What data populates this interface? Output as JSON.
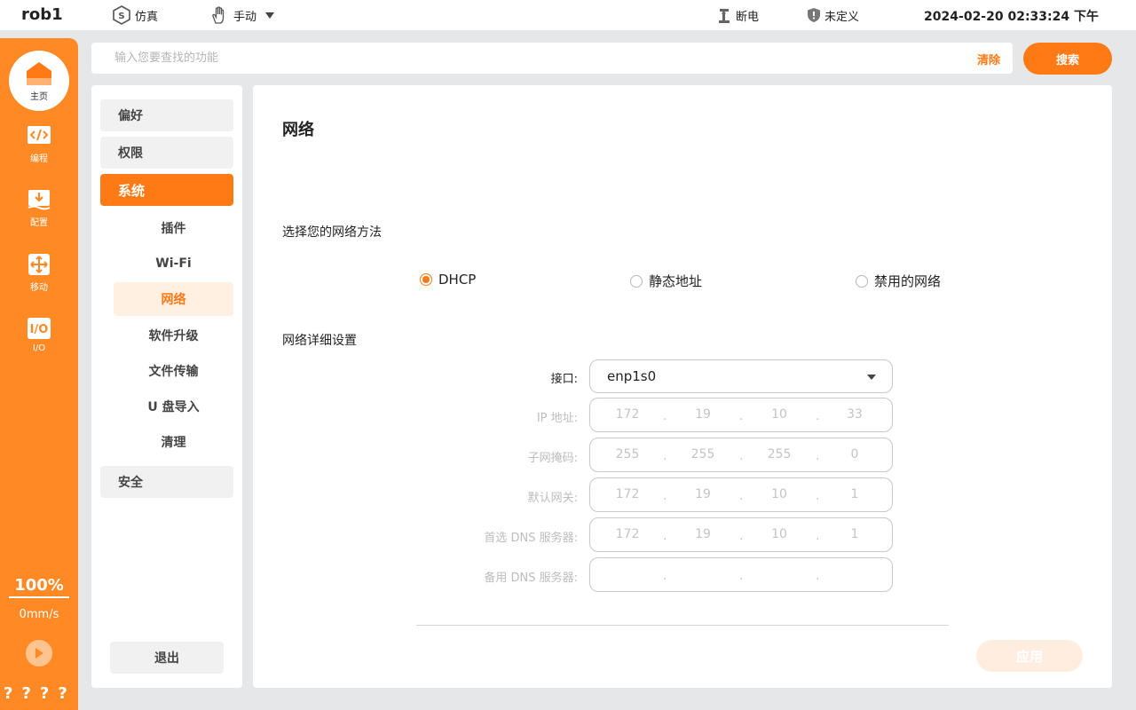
{
  "topbar": {
    "robot_name": "rob1",
    "sim_label": "仿真",
    "mode_label": "手动",
    "power_label": "断电",
    "safety_label": "未定义",
    "datetime": "2024-02-20 02:33:24 下午"
  },
  "rail": {
    "home_label": "主页",
    "items": [
      {
        "label": "编程",
        "icon": "code-icon"
      },
      {
        "label": "配置",
        "icon": "download-config-icon"
      },
      {
        "label": "移动",
        "icon": "move-arrows-icon"
      },
      {
        "label": "I/O",
        "icon": "io-icon"
      }
    ],
    "speed_percent": "100%",
    "speed_mm": "0mm/s",
    "question_marks": [
      "?",
      "?",
      "?",
      "?"
    ]
  },
  "search": {
    "placeholder": "输入您要查找的功能",
    "clear_label": "清除",
    "button_label": "搜索"
  },
  "nav": {
    "top_items": [
      "偏好",
      "权限",
      "系统",
      "安全"
    ],
    "sub_items": [
      "插件",
      "Wi-Fi",
      "网络",
      "软件升级",
      "文件传输",
      "U 盘导入",
      "清理"
    ],
    "logout_label": "退出"
  },
  "network": {
    "title": "网络",
    "method_label": "选择您的网络方法",
    "options": [
      "DHCP",
      "静态地址",
      "禁用的网络"
    ],
    "selected_option": "DHCP",
    "details_label": "网络详细设置",
    "interface_label": "接口:",
    "interface_value": "enp1s0",
    "fields": [
      {
        "label": "IP 地址:",
        "octets": [
          "172",
          "19",
          "10",
          "33"
        ]
      },
      {
        "label": "子网掩码:",
        "octets": [
          "255",
          "255",
          "255",
          "0"
        ]
      },
      {
        "label": "默认网关:",
        "octets": [
          "172",
          "19",
          "10",
          "1"
        ]
      },
      {
        "label": "首选 DNS 服务器:",
        "octets": [
          "172",
          "19",
          "10",
          "1"
        ]
      },
      {
        "label": "备用 DNS 服务器:",
        "octets": [
          "",
          "",
          "",
          ""
        ]
      }
    ],
    "apply_label": "应用"
  },
  "colors": {
    "accent": "#ff7a14",
    "rail": "#ff8a25"
  }
}
